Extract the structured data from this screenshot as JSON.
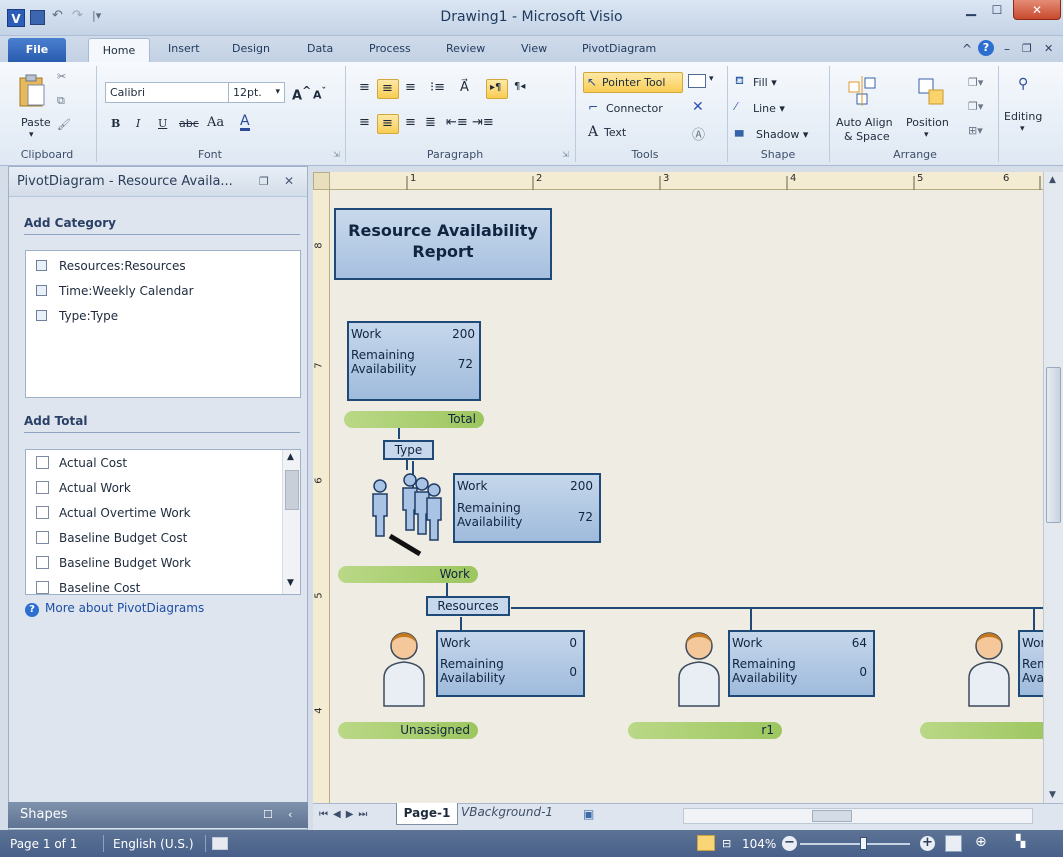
{
  "window": {
    "title": "Drawing1 - Microsoft Visio",
    "app_letter": "V"
  },
  "tabs": {
    "file": "File",
    "items": [
      "Home",
      "Insert",
      "Design",
      "Data",
      "Process",
      "Review",
      "View",
      "PivotDiagram"
    ]
  },
  "ribbon": {
    "clipboard": {
      "label": "Clipboard",
      "paste": "Paste"
    },
    "font": {
      "label": "Font",
      "name": "Calibri",
      "size": "12pt.",
      "bold": "B",
      "italic": "I",
      "underline": "U",
      "strike": "abc",
      "case": "Aa",
      "color": "A"
    },
    "paragraph": {
      "label": "Paragraph"
    },
    "tools": {
      "label": "Tools",
      "pointer": "Pointer Tool",
      "connector": "Connector",
      "text": "Text"
    },
    "shape": {
      "label": "Shape",
      "fill": "Fill",
      "line": "Line",
      "shadow": "Shadow"
    },
    "arrange": {
      "label": "Arrange",
      "auto_align": "Auto Align",
      "auto_align2": "& Space",
      "position": "Position"
    },
    "editing": {
      "label": "Editing"
    }
  },
  "pane": {
    "title": "PivotDiagram - Resource Availa...",
    "add_category": "Add Category",
    "categories": [
      "Resources:Resources",
      "Time:Weekly Calendar",
      "Type:Type"
    ],
    "add_total": "Add Total",
    "totals": [
      "Actual Cost",
      "Actual Work",
      "Actual Overtime Work",
      "Baseline Budget Cost",
      "Baseline Budget Work",
      "Baseline Cost"
    ],
    "help_link": "More about PivotDiagrams"
  },
  "shapes_bar": {
    "label": "Shapes"
  },
  "rulers": {
    "h": [
      "1",
      "2",
      "3",
      "4",
      "5",
      "6"
    ],
    "v": [
      "8",
      "7",
      "6",
      "5",
      "4"
    ]
  },
  "diagram": {
    "title_line1": "Resource Availability",
    "title_line2": "Report",
    "work_label": "Work",
    "remaining_label1": "Remaining",
    "remaining_label2": "Availability",
    "total_node": {
      "work": "200",
      "remaining": "72",
      "label": "Total"
    },
    "type_tag": "Type",
    "type_node": {
      "work": "200",
      "remaining": "72",
      "label": "Work"
    },
    "resources_tag": "Resources",
    "resource_nodes": [
      {
        "work": "0",
        "remaining": "0",
        "label": "Unassigned"
      },
      {
        "work": "64",
        "remaining": "0",
        "label": "r1"
      },
      {
        "work": "Wor",
        "remaining": "Rem",
        "remaining2": "Ava",
        "label": ""
      }
    ]
  },
  "page_tabs": {
    "page1": "Page-1",
    "page2": "VBackground-1"
  },
  "status": {
    "page": "Page 1 of 1",
    "language": "English (U.S.)",
    "zoom": "104%"
  },
  "colors": {
    "node_border": "#1f4a78",
    "node_fill": "#b3c9e4",
    "label_fill": "#a9cf6d",
    "canvas": "#efede3"
  }
}
